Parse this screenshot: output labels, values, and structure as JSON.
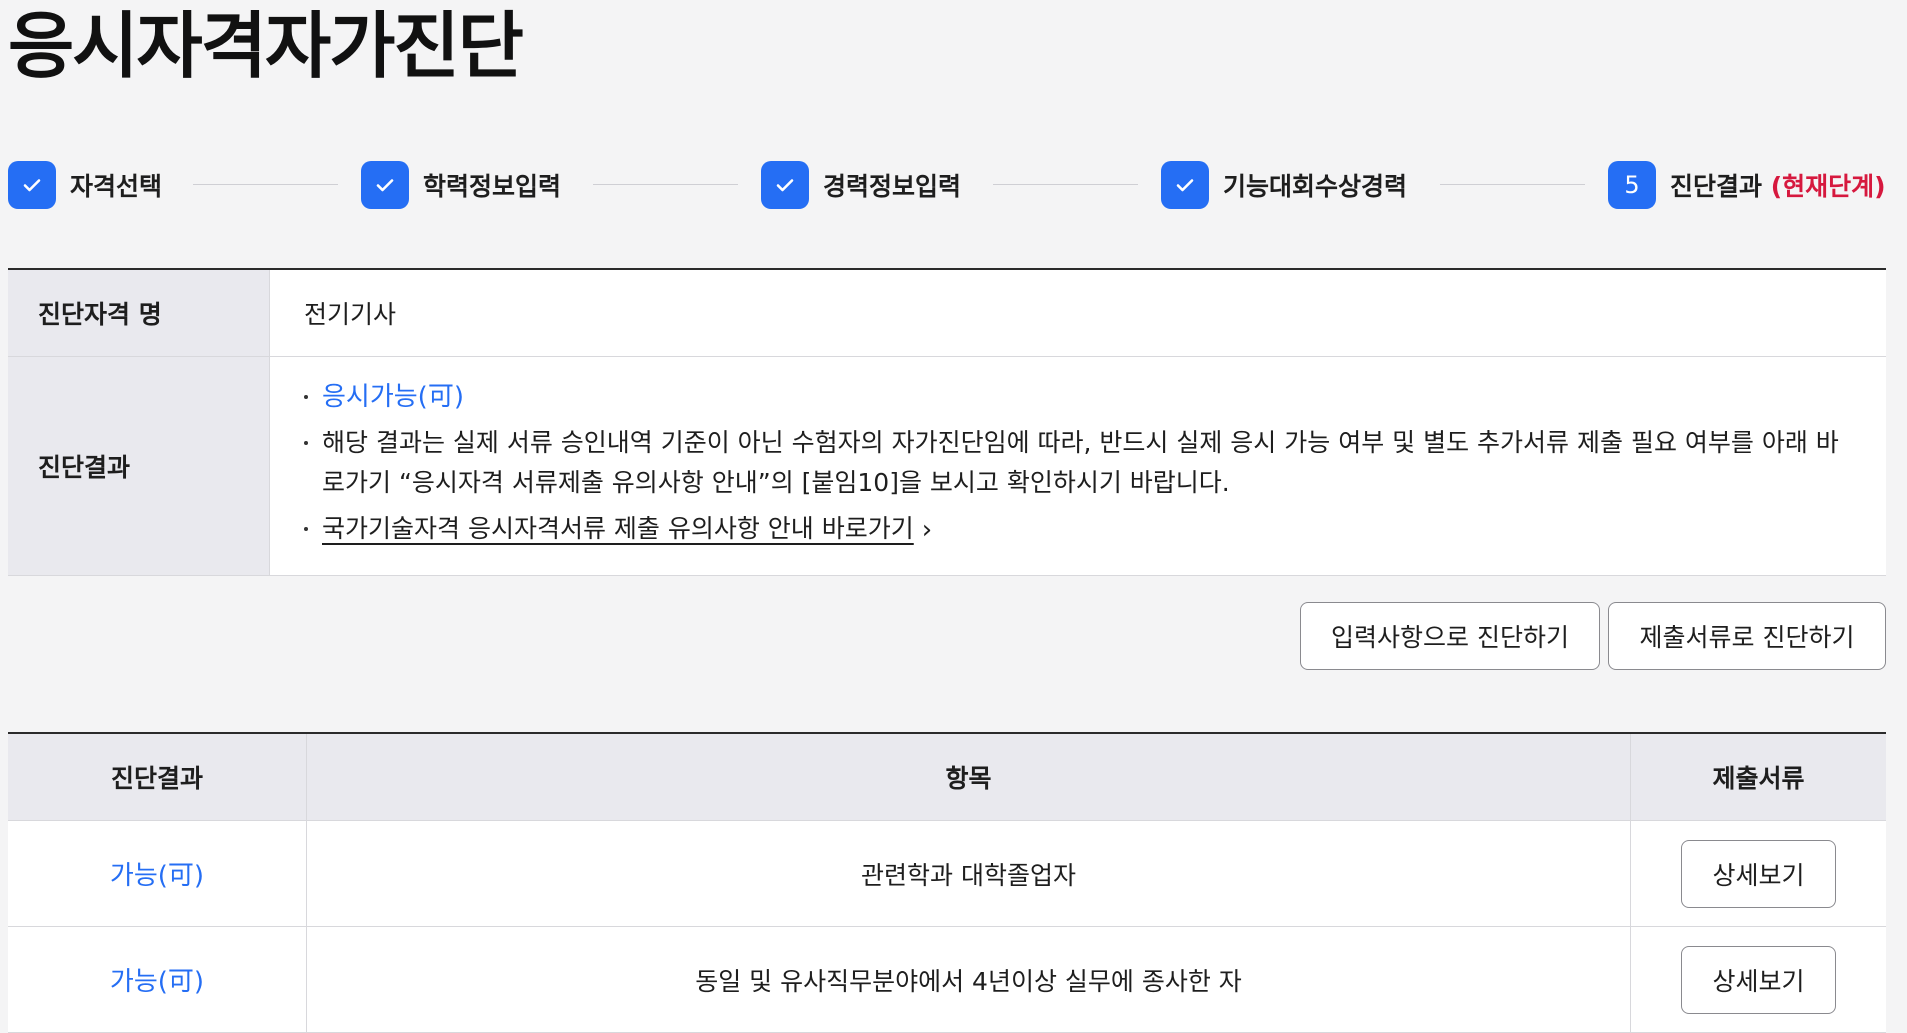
{
  "page_title": "응시자격자가진단",
  "steps": [
    {
      "badge": "",
      "label": "자격선택",
      "done": true
    },
    {
      "badge": "",
      "label": "학력정보입력",
      "done": true
    },
    {
      "badge": "",
      "label": "경력정보입력",
      "done": true
    },
    {
      "badge": "",
      "label": "기능대회수상경력",
      "done": true
    },
    {
      "badge": "5",
      "label": "진단결과",
      "current_note": "(현재단계)",
      "done": false
    }
  ],
  "info": {
    "qual_name_label": "진단자격 명",
    "qual_name_value": "전기기사",
    "result_label": "진단결과",
    "status": "응시가능(可)",
    "notice": "해당 결과는 실제 서류 승인내역 기준이 아닌 수험자의 자가진단임에 따라, 반드시 실제 응시 가능 여부 및 별도 추가서류 제출 필요 여부를 아래 바로가기 “응시자격 서류제출 유의사항 안내”의 [붙임10]을 보시고 확인하시기 바랍니다.",
    "link_text": "국가기술자격 응시자격서류 제출 유의사항 안내 바로가기",
    "link_chevron": "›"
  },
  "actions": {
    "diagnose_by_input": "입력사항으로 진단하기",
    "diagnose_by_docs": "제출서류로 진단하기"
  },
  "result_table": {
    "headers": [
      "진단결과",
      "항목",
      "제출서류"
    ],
    "rows": [
      {
        "result": "가능(可)",
        "item": "관련학과 대학졸업자",
        "action": "상세보기"
      },
      {
        "result": "가능(可)",
        "item": "동일 및 유사직무분야에서 4년이상 실무에 종사한 자",
        "action": "상세보기"
      }
    ]
  },
  "colors": {
    "accent": "#256ef4",
    "current_step": "#d6183e",
    "header_bg": "#e9e9ee",
    "page_bg": "#f4f4f5"
  }
}
